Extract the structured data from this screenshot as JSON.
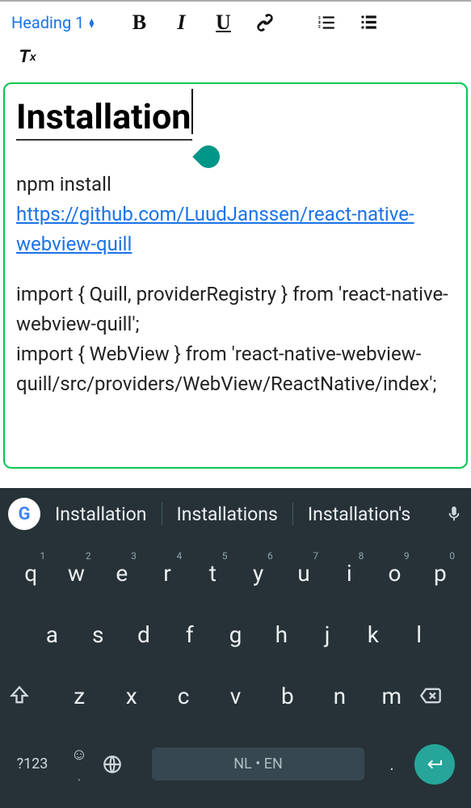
{
  "toolbar": {
    "heading": "Heading 1"
  },
  "doc": {
    "title": "Installation",
    "npm": "npm install ",
    "link": "https://github.com/LuudJanssen/react-native-webview-quill",
    "code1": "import { Quill, providerRegistry } from 'react-native-webview-quill';",
    "code2": "import { WebView } from 'react-native-webview-quill/src/providers/WebView/ReactNative/index';"
  },
  "suggest": [
    "Installation",
    "Installations",
    "Installation's"
  ],
  "rows": {
    "r1": [
      [
        "q",
        "1"
      ],
      [
        "w",
        "2"
      ],
      [
        "e",
        "3"
      ],
      [
        "r",
        "4"
      ],
      [
        "t",
        "5"
      ],
      [
        "y",
        "6"
      ],
      [
        "u",
        "7"
      ],
      [
        "i",
        "8"
      ],
      [
        "o",
        "9"
      ],
      [
        "p",
        "0"
      ]
    ],
    "r2": [
      "a",
      "s",
      "d",
      "f",
      "g",
      "h",
      "j",
      "k",
      "l"
    ],
    "r3": [
      "z",
      "x",
      "c",
      "v",
      "b",
      "n",
      "m"
    ]
  },
  "bottom": {
    "sym": "?123",
    "lang": "NL • EN",
    "dot": "."
  }
}
